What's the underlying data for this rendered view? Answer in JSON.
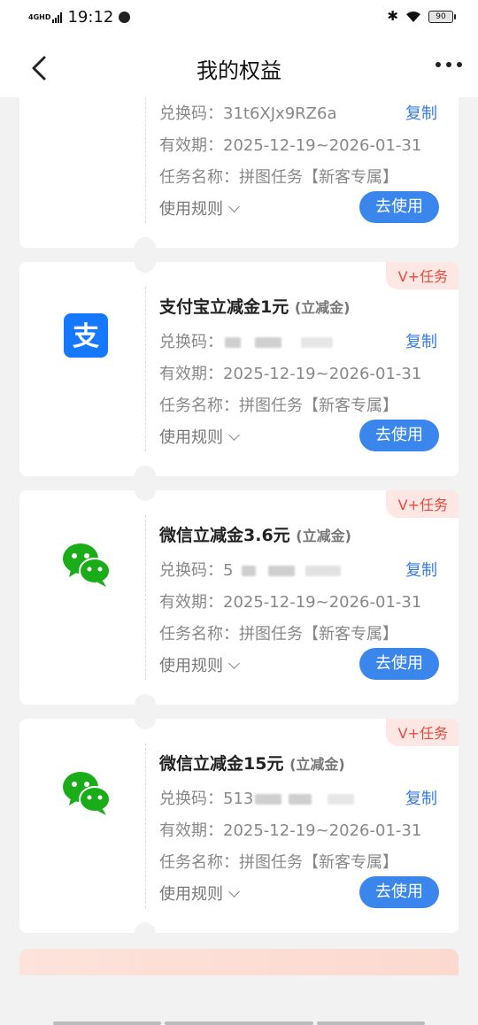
{
  "status": {
    "network": "4GHD",
    "time": "19:12",
    "battery": "90"
  },
  "header": {
    "title": "我的权益"
  },
  "labels": {
    "code": "兑换码：",
    "validity": "有效期：",
    "task": "任务名称：",
    "copy": "复制",
    "rules": "使用规则",
    "use": "去使用"
  },
  "cards": [
    {
      "code": "31t6XJx9RZ6a",
      "validity": "2025-12-19~2026-01-31",
      "task": "拼图任务【新客专属】"
    },
    {
      "badge": "V+任务",
      "name": "支付宝立减金1元",
      "tag": "(立减金)",
      "code_visible": "",
      "validity": "2025-12-19~2026-01-31",
      "task": "拼图任务【新客专属】",
      "logo": "alipay-logo"
    },
    {
      "badge": "V+任务",
      "name": "微信立减金3.6元",
      "tag": "(立减金)",
      "code_visible": "5",
      "validity": "2025-12-19~2026-01-31",
      "task": "拼图任务【新客专属】",
      "logo": "wechat-logo"
    },
    {
      "badge": "V+任务",
      "name": "微信立减金15元",
      "tag": "(立减金)",
      "code_visible": "513",
      "validity": "2025-12-19~2026-01-31",
      "task": "拼图任务【新客专属】",
      "logo": "wechat-logo"
    }
  ],
  "colors": {
    "accent": "#3b86ec",
    "badge_text": "#e64a3c",
    "wechat": "#1aad19",
    "alipay": "#1677ff"
  }
}
